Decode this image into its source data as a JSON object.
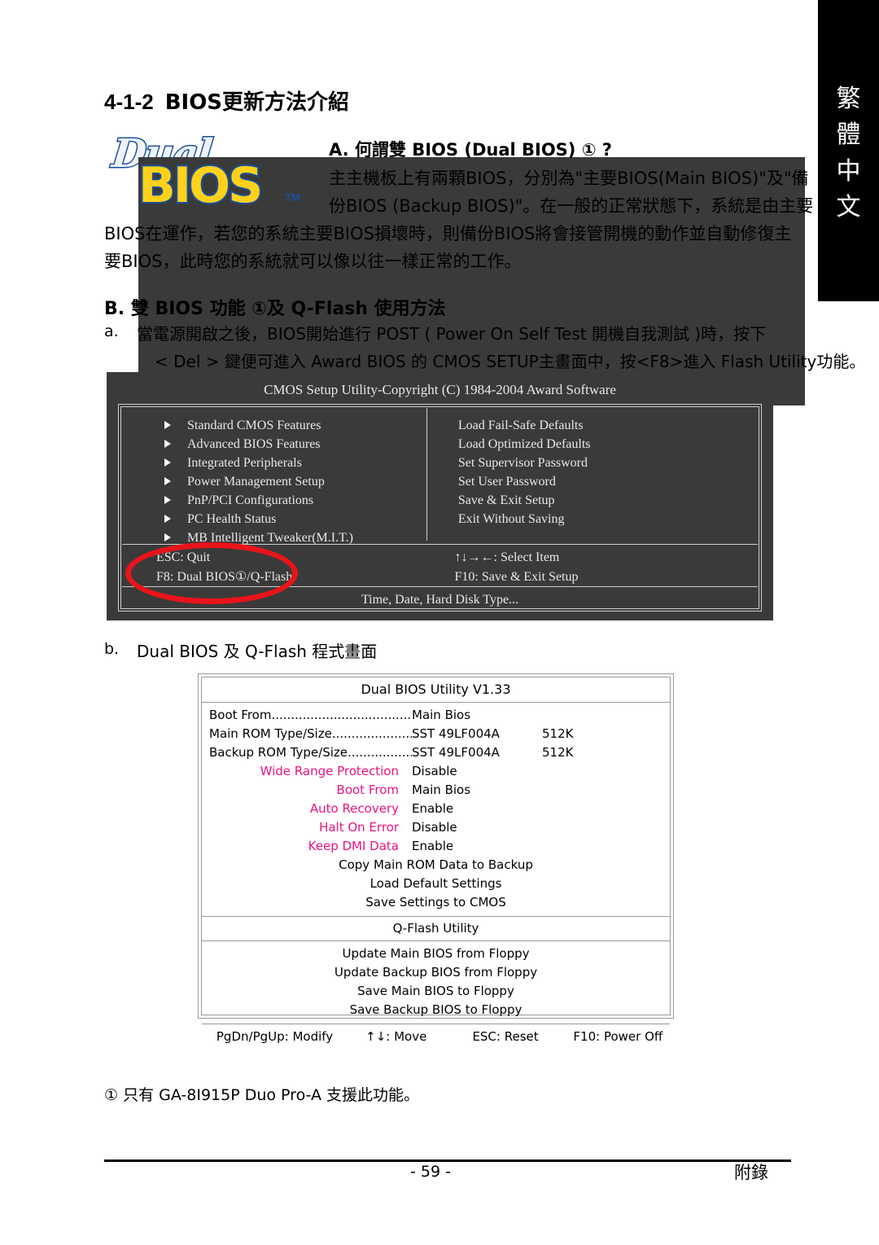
{
  "lang_tab": {
    "chars": [
      "繁",
      "體",
      "中",
      "文"
    ]
  },
  "section": {
    "number": "4-1-2",
    "title": "BIOS更新方法介紹"
  },
  "logo": {
    "dual": "Dual",
    "bios": "BIOS",
    "tm": "TM"
  },
  "part_a": {
    "heading": "A. 何謂雙 BIOS (Dual BIOS) ① ?",
    "line1": "主主機板上有兩顆BIOS，分別為\"主要BIOS(Main BIOS)\"及\"備",
    "line2": "份BIOS (Backup BIOS)\"。在一般的正常狀態下，系統是由主要",
    "line3": "BIOS在運作，若您的系統主要BIOS損壞時，則備份BIOS將會接管開機的動作並自動修復主",
    "line4": "要BIOS，此時您的系統就可以像以往一樣正常的工作。"
  },
  "part_b": {
    "heading": "B. 雙 BIOS 功能 ①及 Q-Flash 使用方法",
    "item_a_marker": "a.",
    "item_a_line1": "當電源開啟之後，BIOS開始進行 POST ( Power On Self Test 開機自我測試 )時，按下",
    "item_a_line2": "< Del > 鍵便可進入 Award BIOS 的 CMOS SETUP主畫面中，按<F8>進入 Flash Utility功能。",
    "item_b_marker": "b.",
    "item_b_line1": "Dual BIOS 及 Q-Flash 程式畫面"
  },
  "cmos_screen": {
    "title": "CMOS Setup Utility-Copyright (C) 1984-2004 Award Software",
    "left_items": [
      "Standard CMOS Features",
      "Advanced BIOS Features",
      "Integrated Peripherals",
      "Power Management Setup",
      "PnP/PCI Configurations",
      "PC Health Status",
      "MB Intelligent Tweaker(M.I.T.)"
    ],
    "right_items": [
      "Load Fail-Safe Defaults",
      "Load Optimized Defaults",
      "Set Supervisor Password",
      "Set User Password",
      "Save & Exit Setup",
      "Exit Without Saving"
    ],
    "keys_left": [
      "ESC: Quit",
      "F8: Dual BIOS①/Q-Flash"
    ],
    "keys_right": [
      "↑↓→←: Select Item",
      "F10: Save & Exit Setup"
    ],
    "status": "Time, Date, Hard Disk Type...",
    "annotation_color": "#e8141a"
  },
  "dual_bios_table": {
    "title": "Dual BIOS Utility V1.33",
    "info_rows": [
      {
        "label": "Boot From...............................................",
        "value": "Main Bios",
        "extra": ""
      },
      {
        "label": "Main ROM Type/Size................................",
        "value": "SST  49LF004A",
        "extra": "512K"
      },
      {
        "label": "Backup ROM Type/Size...........................",
        "value": "SST  49LF004A",
        "extra": "512K"
      }
    ],
    "option_rows": [
      {
        "label": "Wide Range Protection",
        "value": "Disable"
      },
      {
        "label": "Boot From",
        "value": "Main Bios"
      },
      {
        "label": "Auto Recovery",
        "value": "Enable"
      },
      {
        "label": "Halt On Error",
        "value": "Disable"
      },
      {
        "label": "Keep DMI Data",
        "value": "Enable"
      }
    ],
    "action_rows": [
      "Copy Main ROM Data to Backup",
      "Load Default Settings",
      "Save Settings to CMOS"
    ],
    "qflash_title": "Q-Flash Utility",
    "qflash_rows": [
      "Update Main BIOS from Floppy",
      "Update Backup BIOS from Floppy",
      "Save Main BIOS to Floppy",
      "Save Backup BIOS to Floppy"
    ],
    "footer_keys": [
      "PgDn/PgUp: Modify",
      "↑↓: Move",
      "ESC: Reset",
      "F10: Power Off"
    ],
    "highlight_color": "#ed1380"
  },
  "note": "① 只有 GA-8I915P Duo Pro-A 支援此功能。",
  "footer": {
    "page_number": "- 59 -",
    "chapter": "附錄"
  }
}
